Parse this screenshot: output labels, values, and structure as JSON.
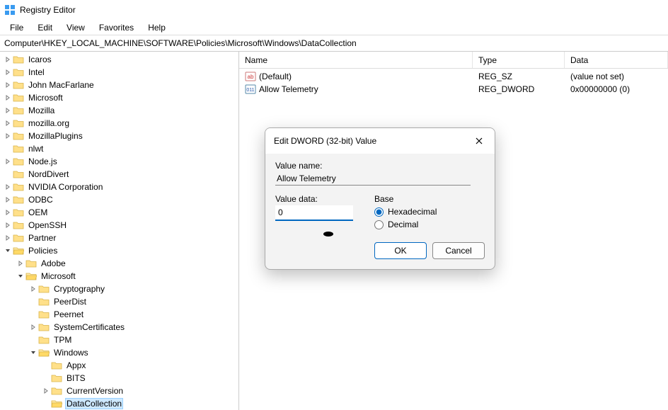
{
  "window": {
    "title": "Registry Editor"
  },
  "menu": {
    "file": "File",
    "edit": "Edit",
    "view": "View",
    "favorites": "Favorites",
    "help": "Help"
  },
  "address": "Computer\\HKEY_LOCAL_MACHINE\\SOFTWARE\\Policies\\Microsoft\\Windows\\DataCollection",
  "tree": [
    {
      "label": "Icaros",
      "depth": 0,
      "arrow": "right",
      "open": false
    },
    {
      "label": "Intel",
      "depth": 0,
      "arrow": "right",
      "open": false
    },
    {
      "label": "John MacFarlane",
      "depth": 0,
      "arrow": "right",
      "open": false
    },
    {
      "label": "Microsoft",
      "depth": 0,
      "arrow": "right",
      "open": false
    },
    {
      "label": "Mozilla",
      "depth": 0,
      "arrow": "right",
      "open": false
    },
    {
      "label": "mozilla.org",
      "depth": 0,
      "arrow": "right",
      "open": false
    },
    {
      "label": "MozillaPlugins",
      "depth": 0,
      "arrow": "right",
      "open": false
    },
    {
      "label": "nlwt",
      "depth": 0,
      "arrow": "none",
      "open": false
    },
    {
      "label": "Node.js",
      "depth": 0,
      "arrow": "right",
      "open": false
    },
    {
      "label": "NordDivert",
      "depth": 0,
      "arrow": "none",
      "open": false
    },
    {
      "label": "NVIDIA Corporation",
      "depth": 0,
      "arrow": "right",
      "open": false
    },
    {
      "label": "ODBC",
      "depth": 0,
      "arrow": "right",
      "open": false
    },
    {
      "label": "OEM",
      "depth": 0,
      "arrow": "right",
      "open": false
    },
    {
      "label": "OpenSSH",
      "depth": 0,
      "arrow": "right",
      "open": false
    },
    {
      "label": "Partner",
      "depth": 0,
      "arrow": "right",
      "open": false
    },
    {
      "label": "Policies",
      "depth": 0,
      "arrow": "down",
      "open": true
    },
    {
      "label": "Adobe",
      "depth": 1,
      "arrow": "right",
      "open": false
    },
    {
      "label": "Microsoft",
      "depth": 1,
      "arrow": "down",
      "open": true
    },
    {
      "label": "Cryptography",
      "depth": 2,
      "arrow": "right",
      "open": false
    },
    {
      "label": "PeerDist",
      "depth": 2,
      "arrow": "none",
      "open": false
    },
    {
      "label": "Peernet",
      "depth": 2,
      "arrow": "none",
      "open": false
    },
    {
      "label": "SystemCertificates",
      "depth": 2,
      "arrow": "right",
      "open": false
    },
    {
      "label": "TPM",
      "depth": 2,
      "arrow": "none",
      "open": false
    },
    {
      "label": "Windows",
      "depth": 2,
      "arrow": "down",
      "open": true
    },
    {
      "label": "Appx",
      "depth": 3,
      "arrow": "none",
      "open": false
    },
    {
      "label": "BITS",
      "depth": 3,
      "arrow": "none",
      "open": false
    },
    {
      "label": "CurrentVersion",
      "depth": 3,
      "arrow": "right",
      "open": false
    },
    {
      "label": "DataCollection",
      "depth": 3,
      "arrow": "none",
      "open": true,
      "selected": true
    }
  ],
  "list": {
    "headers": {
      "name": "Name",
      "type": "Type",
      "data": "Data"
    },
    "rows": [
      {
        "icon": "string",
        "name": "(Default)",
        "type": "REG_SZ",
        "data": "(value not set)"
      },
      {
        "icon": "dword",
        "name": "Allow Telemetry",
        "type": "REG_DWORD",
        "data": "0x00000000 (0)"
      }
    ]
  },
  "dialog": {
    "title": "Edit DWORD (32-bit) Value",
    "value_name_label": "Value name:",
    "value_name": "Allow Telemetry",
    "value_data_label": "Value data:",
    "value_data": "0",
    "base_label": "Base",
    "hex_label": "Hexadecimal",
    "dec_label": "Decimal",
    "base_selected": "hex",
    "ok": "OK",
    "cancel": "Cancel"
  }
}
